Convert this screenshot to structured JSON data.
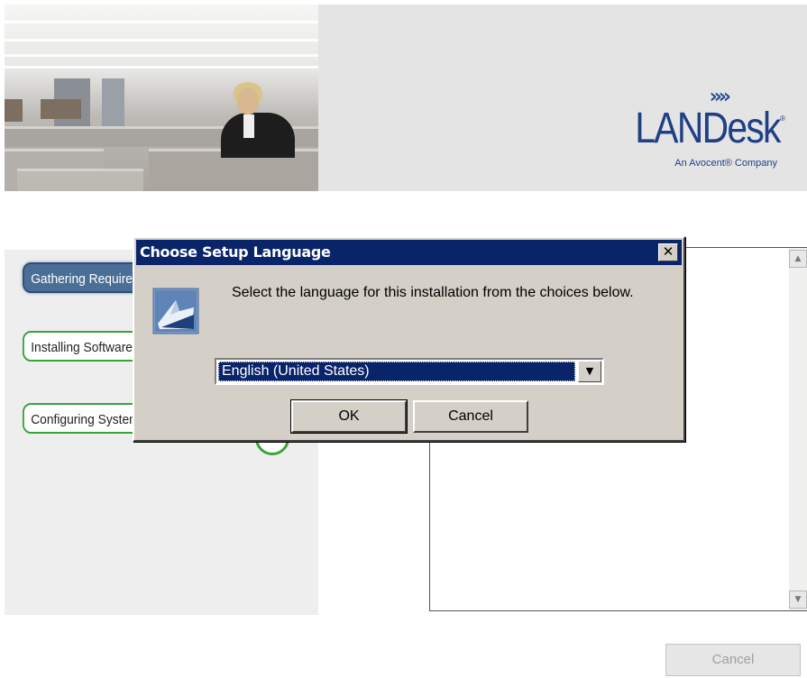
{
  "header": {
    "logo": {
      "chevrons": "»»",
      "wordmark": "LANDesk",
      "registered": "®",
      "tagline": "An Avocent® Company"
    },
    "brand_color": "#1f3f86"
  },
  "steps": {
    "gathering": "Gathering Requirements",
    "installing": "Installing Software",
    "configuring": "Configuring System",
    "active_color": "#4b6e97",
    "pending_color": "#3aa23a"
  },
  "log": {
    "scroll_up": "▲",
    "scroll_down": "▼"
  },
  "main_cancel_label": "Cancel",
  "dialog": {
    "title": "Choose Setup Language",
    "close_glyph": "✕",
    "prompt": "Select the language for this installation from the choices below.",
    "language_selected": "English (United States)",
    "dropdown_glyph": "▼",
    "ok_label": "OK",
    "cancel_label": "Cancel",
    "titlebar_color": "#0a246a",
    "icon": "setup-icon"
  }
}
